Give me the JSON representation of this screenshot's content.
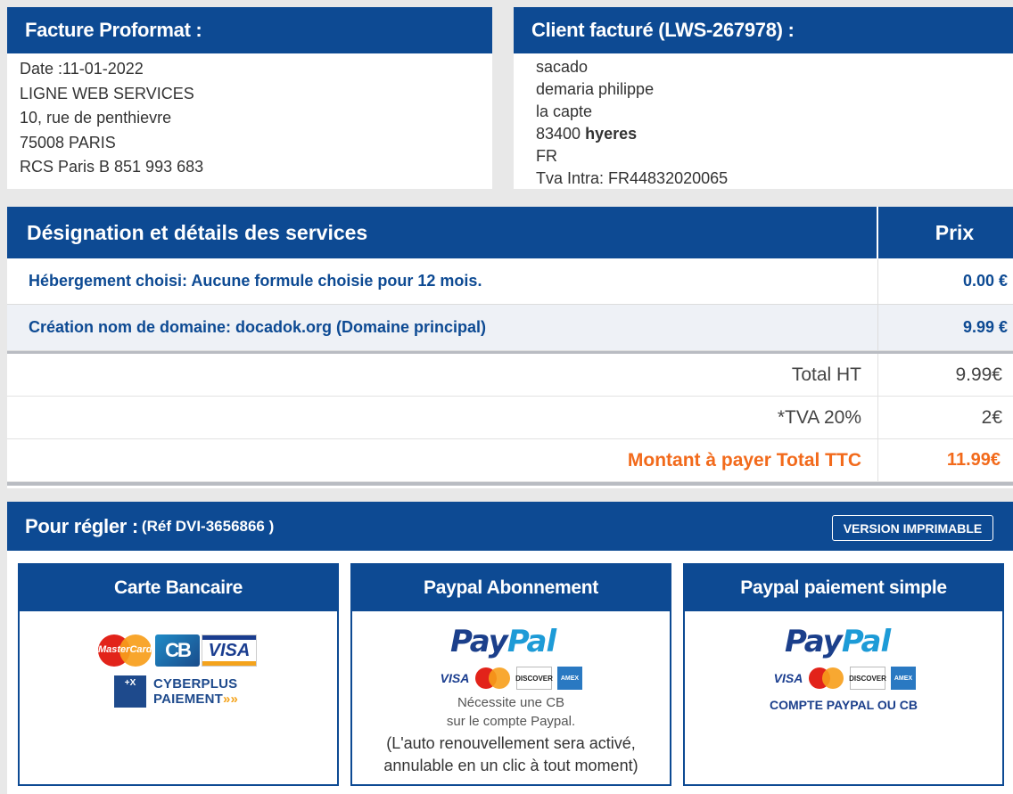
{
  "invoice": {
    "title": "Facture Proformat :",
    "lines": [
      "Date :11-01-2022",
      "LIGNE WEB SERVICES",
      "10, rue de penthievre",
      "75008 PARIS",
      "RCS Paris B 851 993 683"
    ]
  },
  "client": {
    "title": "Client facturé (LWS-267978) :",
    "name": "sacado",
    "contact": "demaria philippe",
    "address": "la capte",
    "postcode": "83400",
    "city": "hyeres",
    "country": "FR",
    "vat": "Tva Intra: FR44832020065"
  },
  "services": {
    "header_designation": "Désignation et détails des services",
    "header_price": "Prix",
    "rows": [
      {
        "designation": "Hébergement choisi: Aucune formule choisie pour 12 mois.",
        "price": "0.00 €"
      },
      {
        "designation": "Création nom de domaine: docadok.org (Domaine principal)",
        "price": "9.99 €"
      }
    ],
    "totals": [
      {
        "label": "Total HT",
        "value": "9.99€"
      },
      {
        "label": "*TVA 20%",
        "value": "2€"
      },
      {
        "label": "Montant à payer Total TTC",
        "value": "11.99€"
      }
    ]
  },
  "payment": {
    "title": "Pour régler :",
    "ref": "(Réf DVI-3656866 )",
    "print_button": "VERSION IMPRIMABLE",
    "accent_color": "#0d4a93",
    "total_color": "#f26a1b",
    "cards": [
      {
        "title": "Carte Bancaire",
        "logos": {
          "mastercard": "MasterCard",
          "cb": "CB",
          "visa": "VISA",
          "cyber_line1": "CYBERPLUS",
          "cyber_line2": "PAIEMENT",
          "cyber_arrows": "»»"
        }
      },
      {
        "title": "Paypal Abonnement",
        "paypal_a": "Pay",
        "paypal_b": "Pal",
        "mini": {
          "visa": "VISA",
          "discover": "DISCOVER",
          "amex": "AMEX"
        },
        "note1": "Nécessite une CB",
        "note2": "sur le compte Paypal.",
        "note3": "(L'auto renouvellement sera activé,",
        "note4": "annulable en un clic à tout moment)"
      },
      {
        "title": "Paypal paiement simple",
        "paypal_a": "Pay",
        "paypal_b": "Pal",
        "mini": {
          "visa": "VISA",
          "discover": "DISCOVER",
          "amex": "AMEX"
        },
        "caption": "COMPTE PAYPAL OU CB"
      }
    ]
  }
}
